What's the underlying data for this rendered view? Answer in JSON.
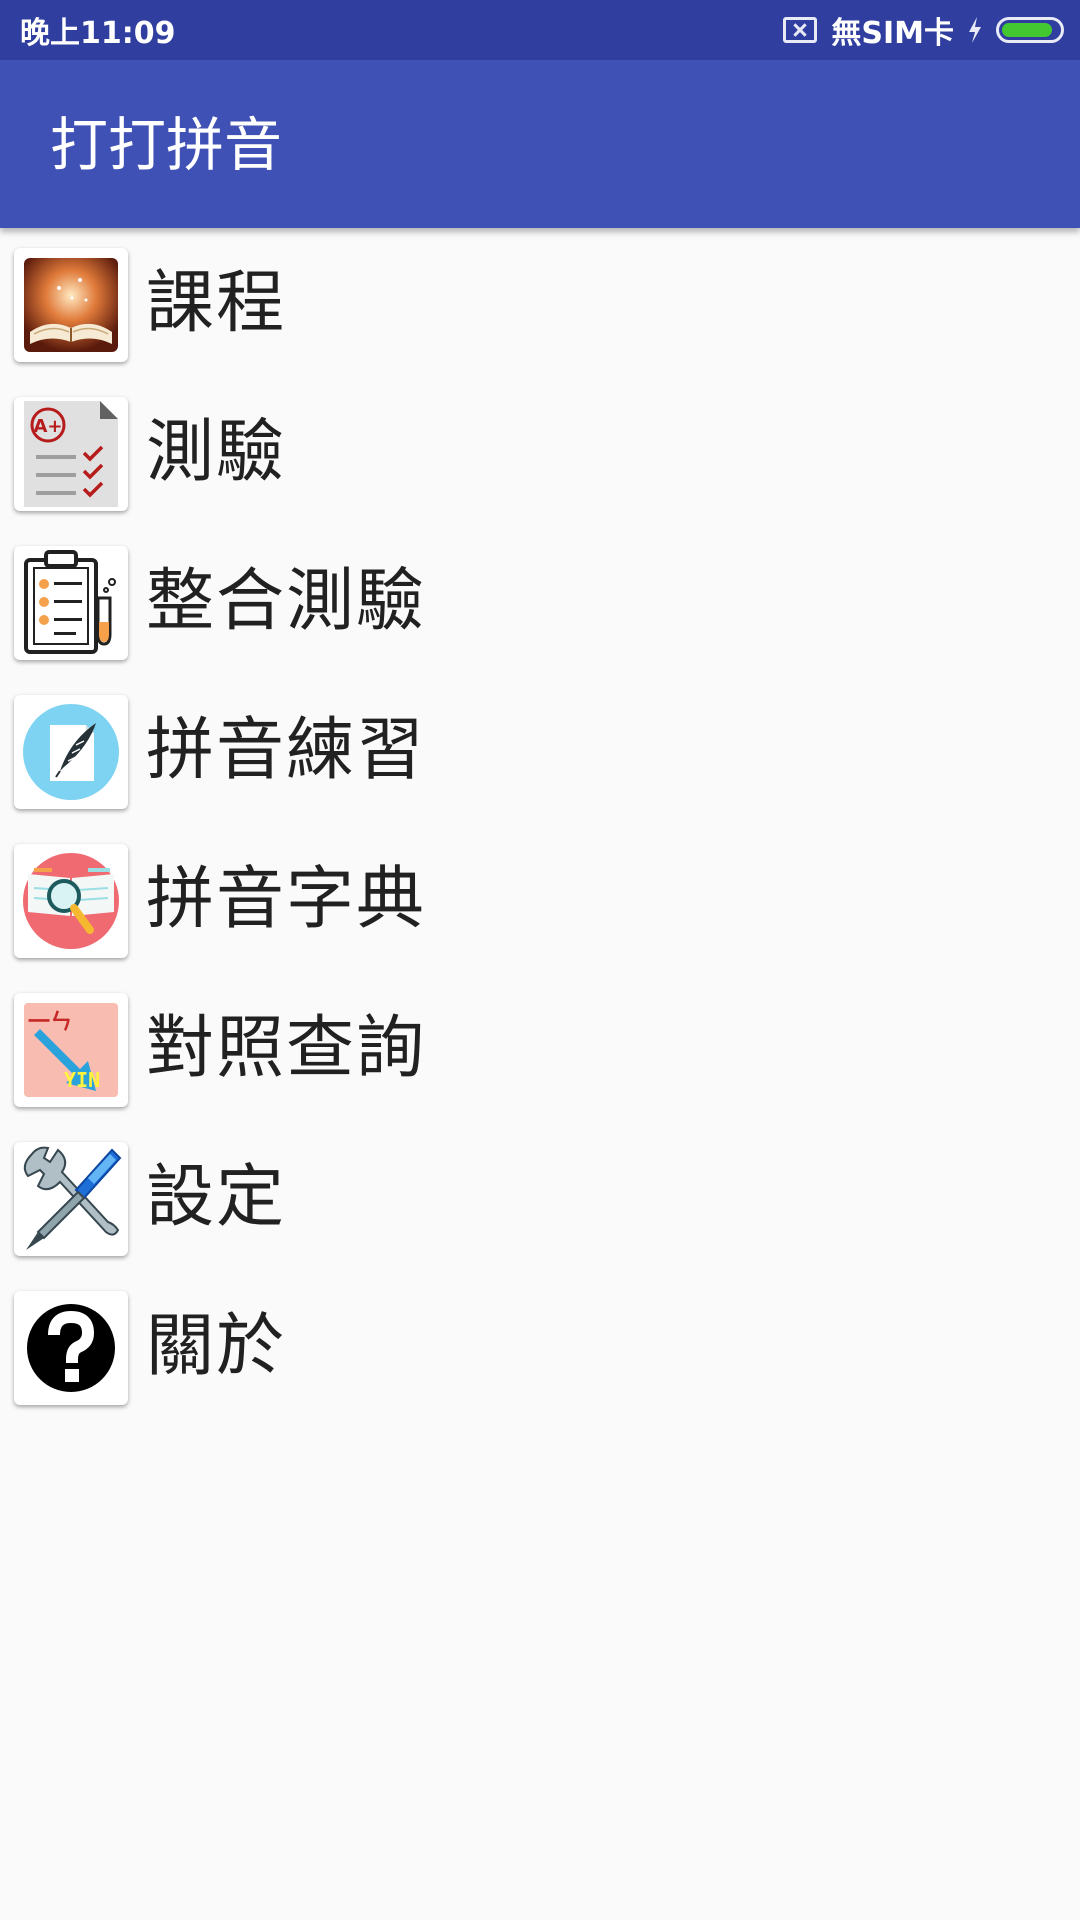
{
  "status_bar": {
    "time": "晚上11:09",
    "sim_text": "無SIM卡",
    "battery_level": 0.9,
    "battery_color": "#43c832"
  },
  "app_bar": {
    "title": "打打拼音",
    "color": "#3f51b5"
  },
  "menu": {
    "items": [
      {
        "label": "課程",
        "icon": "open-book-icon"
      },
      {
        "label": "測驗",
        "icon": "test-checklist-icon"
      },
      {
        "label": "整合測驗",
        "icon": "clipboard-lab-icon"
      },
      {
        "label": "拼音練習",
        "icon": "quill-paper-icon"
      },
      {
        "label": "拼音字典",
        "icon": "magnifier-book-icon"
      },
      {
        "label": "對照查詢",
        "icon": "lookup-arrow-icon"
      },
      {
        "label": "設定",
        "icon": "wrench-screwdriver-icon"
      },
      {
        "label": "關於",
        "icon": "question-icon"
      }
    ]
  },
  "icon_text": {
    "test_grade": "A+",
    "lookup_top": "一ㄣ",
    "lookup_bottom": "YIN"
  }
}
